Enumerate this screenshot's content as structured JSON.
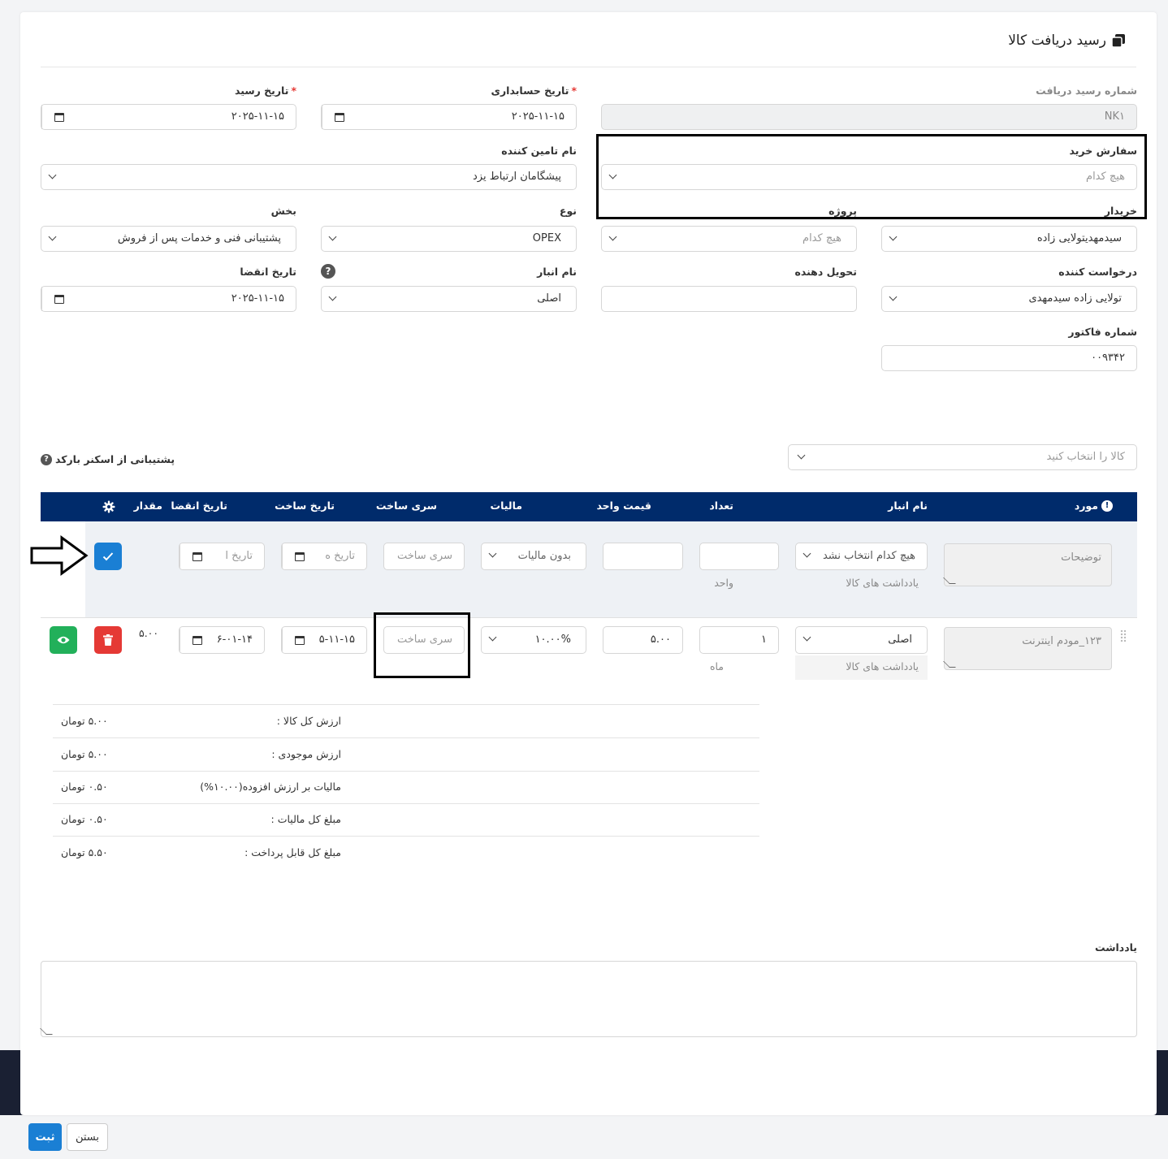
{
  "page": {
    "title": "رسید دریافت کالا"
  },
  "form": {
    "receipt_number": {
      "label": "شماره رسید دریافت",
      "value": "NK۱"
    },
    "accounting_date": {
      "label": "تاریخ حسابداری",
      "required_mark": "*",
      "value": "۲۰۲۵-۱۱-۱۵"
    },
    "receipt_date": {
      "label": "تاریخ رسید",
      "required_mark": "*",
      "value": "۲۰۲۵-۱۱-۱۵"
    },
    "purchase_order": {
      "label": "سفارش خرید",
      "placeholder": "هیچ کدام"
    },
    "supplier": {
      "label": "نام تامین کننده",
      "value": "پیشگامان ارتباط یزد"
    },
    "buyer": {
      "label": "خریدار",
      "value": "سیدمهدیتولایی زاده"
    },
    "project": {
      "label": "پروژه",
      "placeholder": "هیچ کدام"
    },
    "type": {
      "label": "نوع",
      "value": "OPEX"
    },
    "department": {
      "label": "بخش",
      "value": "پشتیبانی فنی و خدمات پس از فروش"
    },
    "requester": {
      "label": "درخواست کننده",
      "value": "تولایی زاده سیدمهدی"
    },
    "deliverer": {
      "label": "تحویل دهنده",
      "value": ""
    },
    "warehouse": {
      "label": "نام انبار",
      "help": "?",
      "value": "اصلی"
    },
    "expiry_date": {
      "label": "تاریخ انقضا",
      "value": "۲۰۲۵-۱۱-۱۵"
    },
    "invoice_number": {
      "label": "شماره فاکتور",
      "value": "۰۰۹۳۴۲"
    }
  },
  "items": {
    "product_picker": {
      "placeholder": "کالا را انتخاب کنید"
    },
    "barcode_label": "پشتیبانی از اسکنر بارکد",
    "barcode_help": "?",
    "headers": {
      "item": "مورد",
      "warehouse": "نام انبار",
      "quantity": "تعداد",
      "unit_price": "قیمت واحد",
      "tax": "مالیات",
      "batch": "سری ساخت",
      "mfg_date": "تاریخ ساخت",
      "expiry": "تاریخ انقضا",
      "amount": "مقدار"
    },
    "new_row": {
      "description_placeholder": "توضیحات",
      "warehouse_placeholder": "هیچ کدام انتخاب نشد",
      "warehouse_note": "یادداشت های کالا",
      "unit_label": "واحد",
      "tax_value": "بدون مالیات",
      "batch_placeholder": "سری ساخت",
      "mfg_placeholder": "تاریخ ه",
      "expiry_placeholder": "تاریخ ا"
    },
    "row1": {
      "description": "۱۲۳_مودم اینترنت",
      "warehouse": "اصلی",
      "warehouse_note": "یادداشت های کالا",
      "quantity": "۱",
      "unit": "ماه",
      "unit_price": "۵.۰۰",
      "tax": "۱۰.۰۰%",
      "batch_placeholder": "سری ساخت",
      "mfg_date": "۵-۱۱-۱۵",
      "expiry_date": "۶-۰۱-۱۴",
      "amount": "۵.۰۰"
    }
  },
  "summary": [
    {
      "label": "ارزش کل کالا :",
      "value": "۵.۰۰ تومان"
    },
    {
      "label": "ارزش موجودی :",
      "value": "۵.۰۰ تومان"
    },
    {
      "label": "مالیات بر ارزش افزوده(۱۰.۰۰%)",
      "value": "۰.۵۰ تومان"
    },
    {
      "label": "مبلغ کل مالیات :",
      "value": "۰.۵۰ تومان"
    },
    {
      "label": "مبلغ کل قابل پرداخت :",
      "value": "۵.۵۰ تومان"
    }
  ],
  "note": {
    "label": "یادداشت",
    "value": ""
  },
  "footer": {
    "submit_label": "ثبت",
    "close_label": "بستن"
  },
  "colors": {
    "header_bg": "#002b6b",
    "primary": "#1a7fd4",
    "danger": "#e53935",
    "success": "#22b05a"
  }
}
